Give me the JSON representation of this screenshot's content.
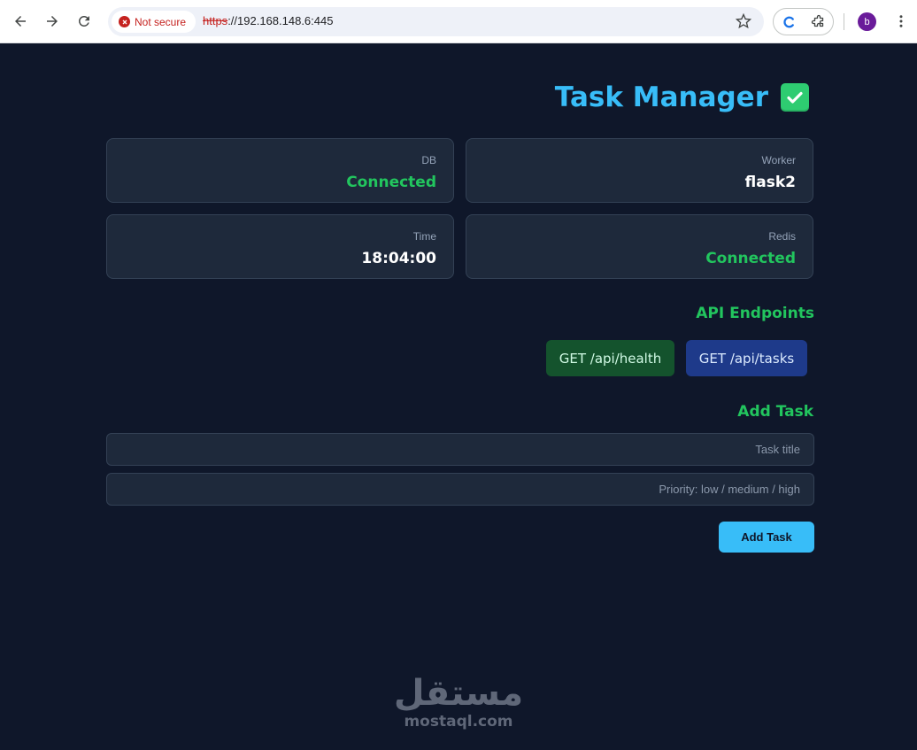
{
  "browser": {
    "security_label": "Not secure",
    "url_scheme": "https",
    "url_rest": "://192.168.148.6:445",
    "profile_initial": "b",
    "icons": [
      "back-arrow-icon",
      "forward-arrow-icon",
      "reload-icon",
      "not-secure-icon",
      "star-icon",
      "extension-c-icon",
      "puzzle-icon",
      "more-vert-icon"
    ]
  },
  "header": {
    "title": "Task Manager",
    "icon": "check-mark-button-icon"
  },
  "status_cards": [
    {
      "label": "DB",
      "value": "Connected",
      "color": "#22c55e"
    },
    {
      "label": "Worker",
      "value": "flask2",
      "color": "#ffffff"
    },
    {
      "label": "Time",
      "value": "18:04:00",
      "color": "#ffffff"
    },
    {
      "label": "Redis",
      "value": "Connected",
      "color": "#22c55e"
    }
  ],
  "api": {
    "title": "API Endpoints",
    "health_label": "GET /api/health",
    "tasks_label": "GET /api/tasks"
  },
  "add_task": {
    "title": "Add Task",
    "title_placeholder": "Task title",
    "priority_placeholder": "Priority: low / medium / high",
    "submit_label": "Add Task"
  },
  "watermark": {
    "arabic": "مستقل",
    "latin": "mostaql.com"
  },
  "colors": {
    "background": "#0f172a",
    "card": "#1e293b",
    "accent_blue": "#38bdf8",
    "accent_green": "#22c55e"
  }
}
